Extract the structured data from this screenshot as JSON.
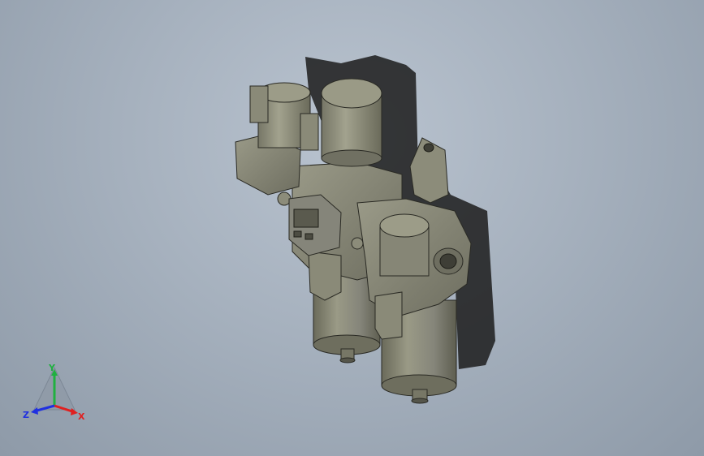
{
  "viewport": {
    "background": "#a9b3bf"
  },
  "model": {
    "body_color": "#7f7f6e",
    "shadow_color": "#2a2a2a"
  },
  "triad": {
    "x_label": "X",
    "y_label": "Y",
    "z_label": "Z",
    "x_color": "#e02020",
    "y_color": "#20b040",
    "z_color": "#2030e0"
  }
}
